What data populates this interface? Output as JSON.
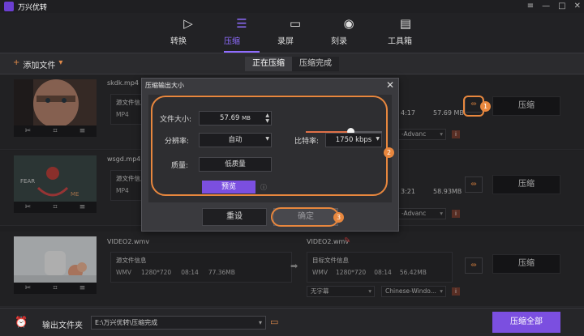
{
  "app": {
    "title": "万兴优转",
    "window_buttons": [
      "≡",
      "—",
      "□",
      "✕"
    ]
  },
  "nav": [
    {
      "label": "转换",
      "icon": "play-circle-icon",
      "glyph": "▷"
    },
    {
      "label": "压缩",
      "icon": "compress-icon",
      "glyph": "☰"
    },
    {
      "label": "录屏",
      "icon": "screen-record-icon",
      "glyph": "▭"
    },
    {
      "label": "刻录",
      "icon": "burn-disc-icon",
      "glyph": "◉"
    },
    {
      "label": "工具箱",
      "icon": "toolbox-icon",
      "glyph": "▤"
    }
  ],
  "toolbar": {
    "add_icon": "+",
    "add_label": "添加文件",
    "add_caret": "▾",
    "tabs": [
      "正在压缩",
      "压缩完成"
    ]
  },
  "files": [
    {
      "name": "skdk.mp4",
      "src_title": "源文件信息",
      "format": "MP4",
      "duration": "4:17",
      "size": "57.69 MB",
      "compress_label": "压缩",
      "profile_tail": "-Advanc"
    },
    {
      "name": "wsgd.mp4",
      "src_title": "源文件信息",
      "format": "MP4",
      "duration": "3:21",
      "size": "58.93MB",
      "compress_label": "压缩",
      "profile_tail": "-Advanc"
    },
    {
      "name": "VIDEO2.wmv",
      "src_title": "源文件信息",
      "format": "WMV",
      "resolution": "1280*720",
      "duration": "08:14",
      "src_size": "77.36MB",
      "target_name": "VIDEO2.wmv",
      "target_title": "目标文件信息",
      "target_format": "WMV",
      "target_resolution": "1280*720",
      "target_duration": "08:14",
      "target_size": "56.42MB",
      "subtitle": "无字幕",
      "audio": "Chinese-Windo...",
      "compress_label": "压缩"
    }
  ],
  "dialog": {
    "title": "压缩输出大小",
    "close": "✕",
    "file_size_label": "文件大小:",
    "file_size": "57.69",
    "file_size_unit": "MB",
    "resolution_label": "分辨率:",
    "resolution": "自动",
    "bitrate_label": "比特率:",
    "bitrate": "1750 kbps",
    "quality_label": "质量:",
    "quality": "低质量",
    "slider_fraction": 0.58,
    "preview": "预览",
    "reset": "重设",
    "ok": "确定"
  },
  "badges": [
    "1",
    "2",
    "3"
  ],
  "bottom": {
    "output_label": "输出文件夹",
    "output_path": "E:\\万兴优转\\压缩完成",
    "compress_all": "压缩全部"
  },
  "colors": {
    "accent": "#7b4fe0",
    "highlight": "#e8873e"
  }
}
